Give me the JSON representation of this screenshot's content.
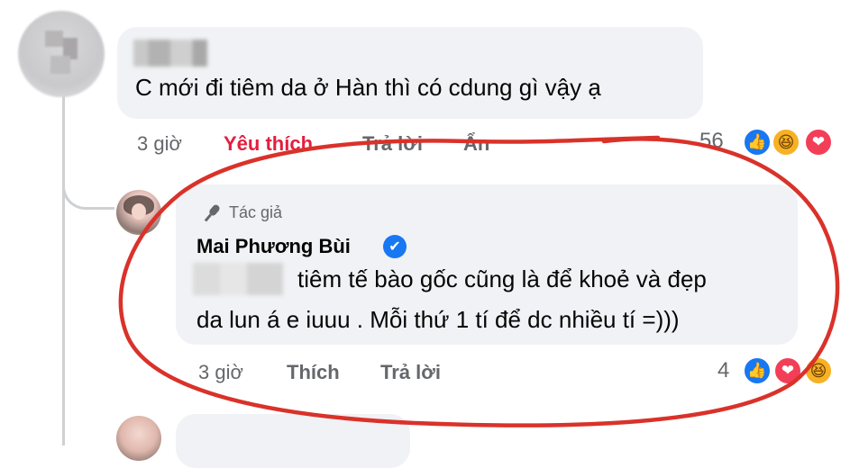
{
  "comment1": {
    "text": "C mới đi tiêm da ở Hàn thì có cdung gì vậy ạ",
    "time": "3 giờ",
    "like_label": "Yêu thích",
    "reply_label": "Trả lời",
    "hide_label": "Ẩn",
    "reaction_count": "56",
    "reactions": [
      "like-icon",
      "haha-icon",
      "love-icon"
    ]
  },
  "reply": {
    "badge": "Tác giả",
    "author": "Mai Phương Bùi",
    "text_line1": "tiêm tế bào gốc cũng là để khoẻ và đẹp",
    "text_line2": "da lun á e iuuu . Mỗi thứ 1 tí để dc nhiều tí =)))",
    "time": "3 giờ",
    "like_label": "Thích",
    "reply_label": "Trả lời",
    "reaction_count": "4",
    "reactions": [
      "like-icon",
      "love-icon",
      "haha-icon"
    ]
  },
  "colors": {
    "bubble": "#f0f2f5",
    "meta_text": "#65676b",
    "liked": "#e41e3f",
    "annotation": "#d9322a",
    "verified": "#1877f2"
  }
}
